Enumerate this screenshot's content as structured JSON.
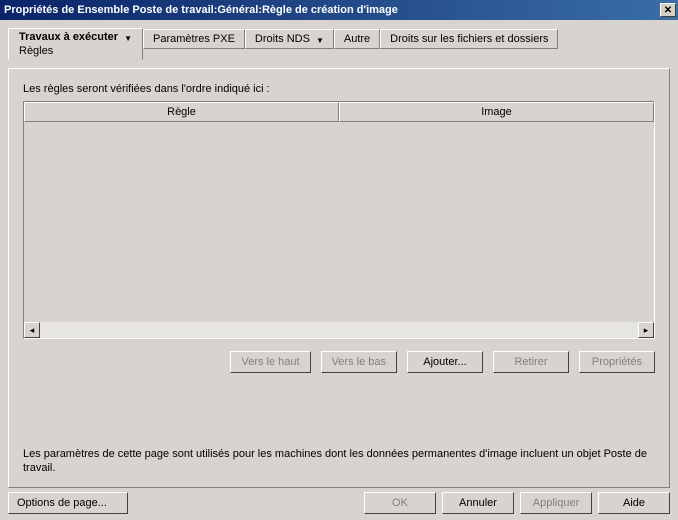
{
  "titlebar": {
    "title": "Propriétés de Ensemble Poste de travail:Général:Règle de création d'image",
    "close_symbol": "✕"
  },
  "tabs": {
    "t0": {
      "label": "Travaux à exécuter",
      "sublabel": "Règles"
    },
    "t1": {
      "label": "Paramètres PXE"
    },
    "t2": {
      "label": "Droits NDS"
    },
    "t3": {
      "label": "Autre"
    },
    "t4": {
      "label": "Droits sur les fichiers et dossiers"
    }
  },
  "content": {
    "hint": "Les règles seront vérifiées dans l'ordre indiqué ici :",
    "col_rule": "Règle",
    "col_image": "Image",
    "info": "Les paramètres de cette page sont utilisés pour les machines dont les données permanentes d'image incluent un objet Poste de travail."
  },
  "buttons": {
    "up": "Vers le haut",
    "down": "Vers le bas",
    "add": "Ajouter...",
    "remove": "Retirer",
    "props": "Propriétés"
  },
  "footer": {
    "page_opts": "Options de page...",
    "ok": "OK",
    "cancel": "Annuler",
    "apply": "Appliquer",
    "help": "Aide"
  },
  "scroll": {
    "left": "◂",
    "right": "▸"
  }
}
